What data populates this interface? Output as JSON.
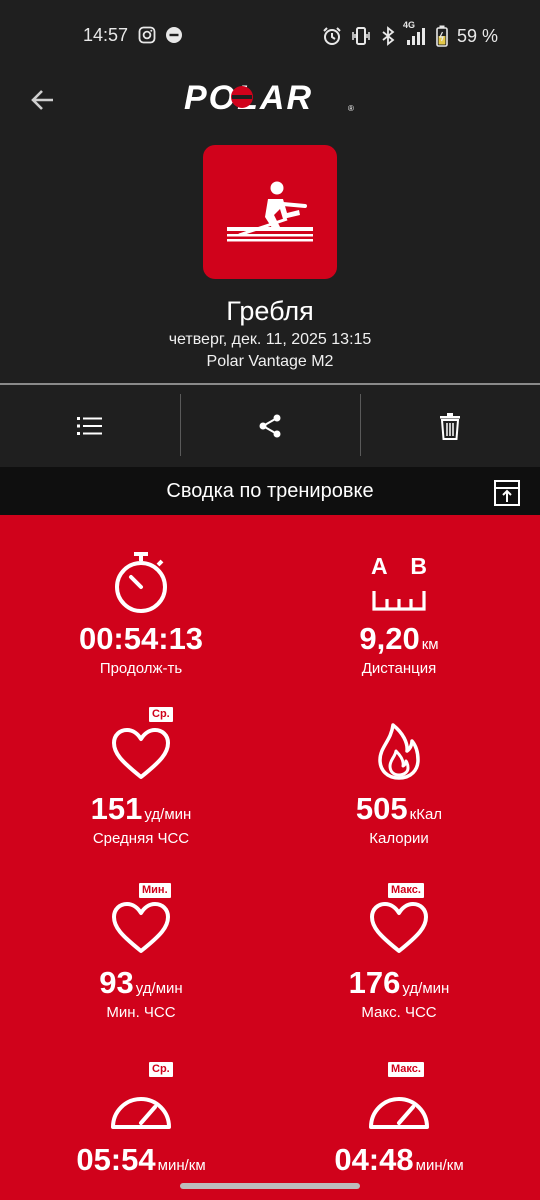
{
  "status": {
    "time": "14:57",
    "network": "4G",
    "battery": "59 %",
    "icons": [
      "instagram-icon",
      "chat-icon",
      "alarm-icon",
      "vibrate-icon",
      "bluetooth-icon",
      "signal-icon",
      "battery-icon"
    ]
  },
  "header": {
    "brand": "POLAR",
    "sport_name": "Гребля",
    "date": "четверг, дек. 11, 2025 13:15",
    "device": "Polar Vantage M2",
    "sport_icon": "rowing-icon"
  },
  "actions": [
    {
      "icon": "list-icon"
    },
    {
      "icon": "share-icon"
    },
    {
      "icon": "trash-icon"
    }
  ],
  "summary": {
    "title": "Сводка по тренировке"
  },
  "stats": {
    "duration": {
      "value": "00:54:13",
      "unit": "",
      "label": "Продолж-ть"
    },
    "distance": {
      "value": "9,20",
      "unit": "км",
      "label": "Дистанция",
      "icon_a": "A",
      "icon_b": "B"
    },
    "avg_hr": {
      "value": "151",
      "unit": "уд/мин",
      "label": "Средняя ЧСС",
      "badge": "Ср."
    },
    "calories": {
      "value": "505",
      "unit": "кКал",
      "label": "Калории"
    },
    "min_hr": {
      "value": "93",
      "unit": "уд/мин",
      "label": "Мин. ЧСС",
      "badge": "Мин."
    },
    "max_hr": {
      "value": "176",
      "unit": "уд/мин",
      "label": "Макс. ЧСС",
      "badge": "Макс."
    },
    "avg_pace": {
      "value": "05:54",
      "unit": "мин/км",
      "badge": "Ср."
    },
    "max_pace": {
      "value": "04:48",
      "unit": "мин/км",
      "badge": "Макс."
    }
  },
  "colors": {
    "accent": "#d0021b",
    "dark": "#1f1f1f"
  }
}
